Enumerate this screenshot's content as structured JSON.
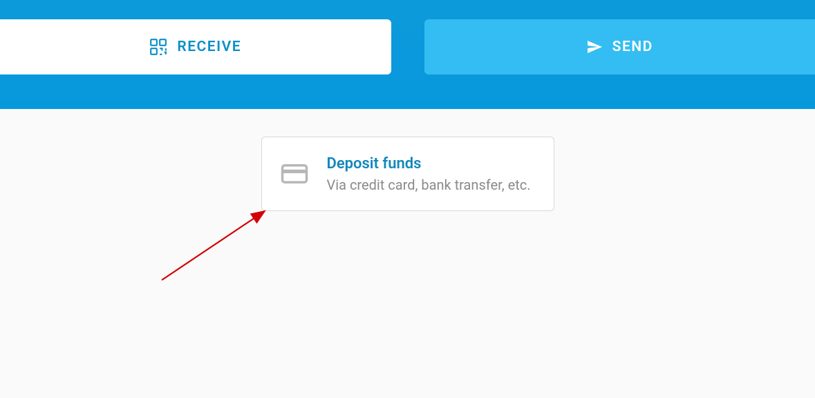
{
  "header": {
    "tabs": {
      "receive": {
        "label": "RECEIVE"
      },
      "send": {
        "label": "SEND"
      }
    }
  },
  "content": {
    "deposit_card": {
      "title": "Deposit funds",
      "subtitle": "Via credit card, bank transfer, etc."
    }
  },
  "annotation": {
    "type": "arrow",
    "color": "#d40000"
  }
}
